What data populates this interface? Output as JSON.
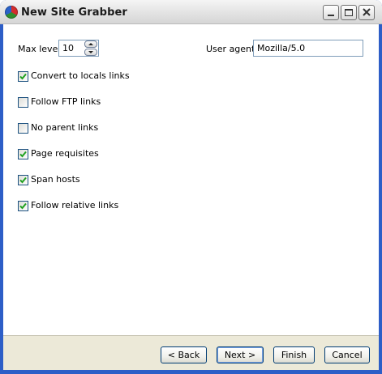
{
  "window": {
    "title": "New Site Grabber",
    "icon": "site-grabber-app-icon"
  },
  "form": {
    "max_level": {
      "label": "Max level:",
      "value": "10"
    },
    "user_agent": {
      "label": "User agent:",
      "value": "Mozilla/5.0"
    },
    "options": [
      {
        "label": "Convert to locals links",
        "checked": true
      },
      {
        "label": "Follow FTP links",
        "checked": false
      },
      {
        "label": "No parent links",
        "checked": false
      },
      {
        "label": "Page requisites",
        "checked": true
      },
      {
        "label": "Span hosts",
        "checked": true
      },
      {
        "label": "Follow relative links",
        "checked": true
      }
    ]
  },
  "buttons": {
    "back": "< Back",
    "next": "Next >",
    "finish": "Finish",
    "cancel": "Cancel"
  },
  "colors": {
    "check_mark": "#21a121",
    "checkbox_border": "#1c5180",
    "button_border": "#003c74",
    "bottom_bar": "#ece9d8"
  }
}
